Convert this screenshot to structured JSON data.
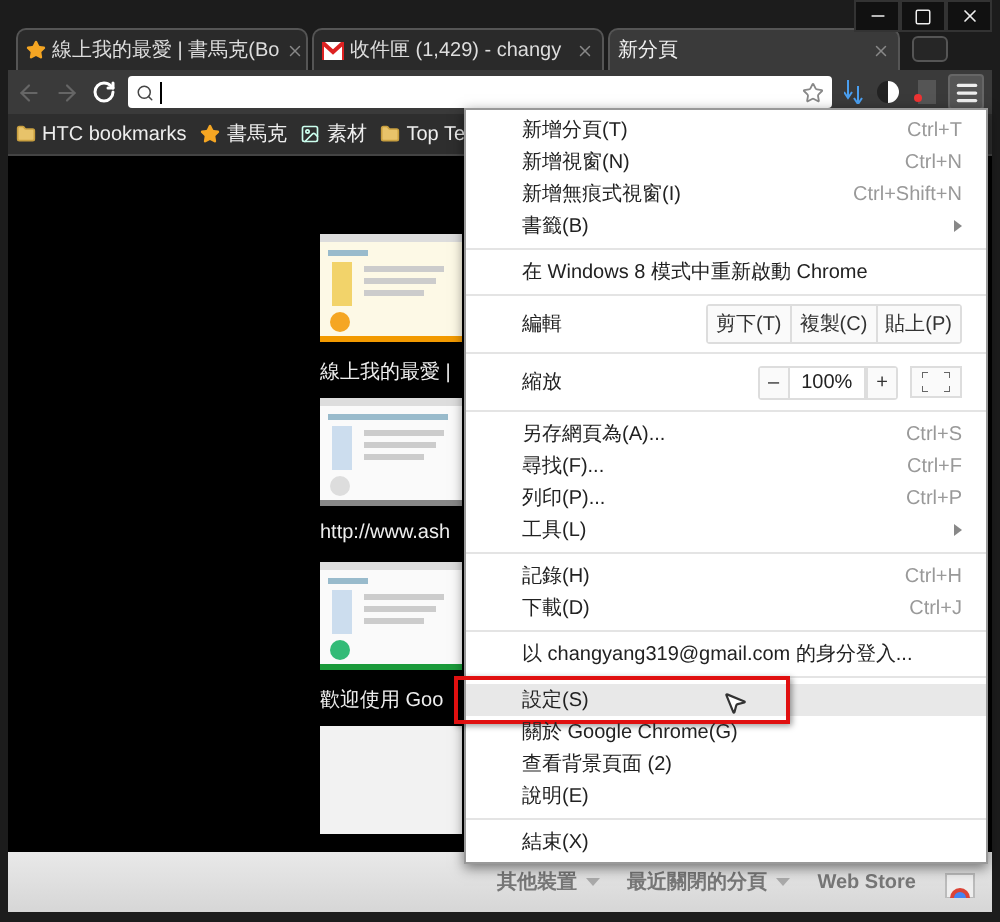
{
  "tabs": [
    {
      "title": "線上我的最愛 | 書馬克(Bo",
      "selected": false
    },
    {
      "title": "收件匣 (1,429) - changy",
      "selected": false
    },
    {
      "title": "新分頁",
      "selected": true
    }
  ],
  "bookmarks": [
    {
      "label": "HTC bookmarks"
    },
    {
      "label": "書馬克"
    },
    {
      "label": "素材"
    },
    {
      "label": "Top Te"
    }
  ],
  "thumbnails": [
    {
      "kind": "thumbnail",
      "title": "線上我的最愛 |"
    },
    {
      "kind": "thumbnail",
      "title": "http://www.ash"
    },
    {
      "kind": "thumbnail",
      "title": "歡迎使用 Goo"
    },
    {
      "kind": "blank"
    }
  ],
  "menu": {
    "sections": [
      [
        {
          "kind": "item",
          "label": "新增分頁(T)",
          "shortcut": "Ctrl+T",
          "hovered": false
        },
        {
          "kind": "item",
          "label": "新增視窗(N)",
          "shortcut": "Ctrl+N",
          "hovered": false
        },
        {
          "kind": "item",
          "label": "新增無痕式視窗(I)",
          "shortcut": "Ctrl+Shift+N",
          "hovered": false
        },
        {
          "kind": "submenu",
          "label": "書籤(B)",
          "hovered": false
        }
      ],
      [
        {
          "kind": "item",
          "label": "在 Windows 8 模式中重新啟動 Chrome",
          "hovered": false
        }
      ],
      [
        {
          "kind": "edit",
          "label": "編輯",
          "buttons": [
            "剪下(T)",
            "複製(C)",
            "貼上(P)"
          ]
        }
      ],
      [
        {
          "kind": "zoom",
          "label": "縮放",
          "minus": "–",
          "value": "100%",
          "plus": "+"
        }
      ],
      [
        {
          "kind": "item",
          "label": "另存網頁為(A)...",
          "shortcut": "Ctrl+S",
          "hovered": false
        },
        {
          "kind": "item",
          "label": "尋找(F)...",
          "shortcut": "Ctrl+F",
          "hovered": false
        },
        {
          "kind": "item",
          "label": "列印(P)...",
          "shortcut": "Ctrl+P",
          "hovered": false
        },
        {
          "kind": "submenu",
          "label": "工具(L)",
          "hovered": false
        }
      ],
      [
        {
          "kind": "item",
          "label": "記錄(H)",
          "shortcut": "Ctrl+H",
          "hovered": false
        },
        {
          "kind": "item",
          "label": "下載(D)",
          "shortcut": "Ctrl+J",
          "hovered": false
        }
      ],
      [
        {
          "kind": "item",
          "label": "以 changyang319@gmail.com 的身分登入...",
          "hovered": false
        }
      ],
      [
        {
          "kind": "item",
          "label": "設定(S)",
          "hovered": true,
          "outlined": true
        },
        {
          "kind": "item",
          "label": "關於 Google Chrome(G)",
          "hovered": false
        },
        {
          "kind": "item",
          "label": "查看背景頁面 (2)",
          "hovered": false
        },
        {
          "kind": "item",
          "label": "說明(E)",
          "hovered": false
        }
      ],
      [
        {
          "kind": "item",
          "label": "結束(X)",
          "hovered": false
        }
      ]
    ]
  },
  "bottom_bar": {
    "items": [
      {
        "label": "其他裝置",
        "dropdown": true
      },
      {
        "label": "最近關閉的分頁",
        "dropdown": true
      },
      {
        "label": "Web Store",
        "dropdown": false
      }
    ]
  }
}
